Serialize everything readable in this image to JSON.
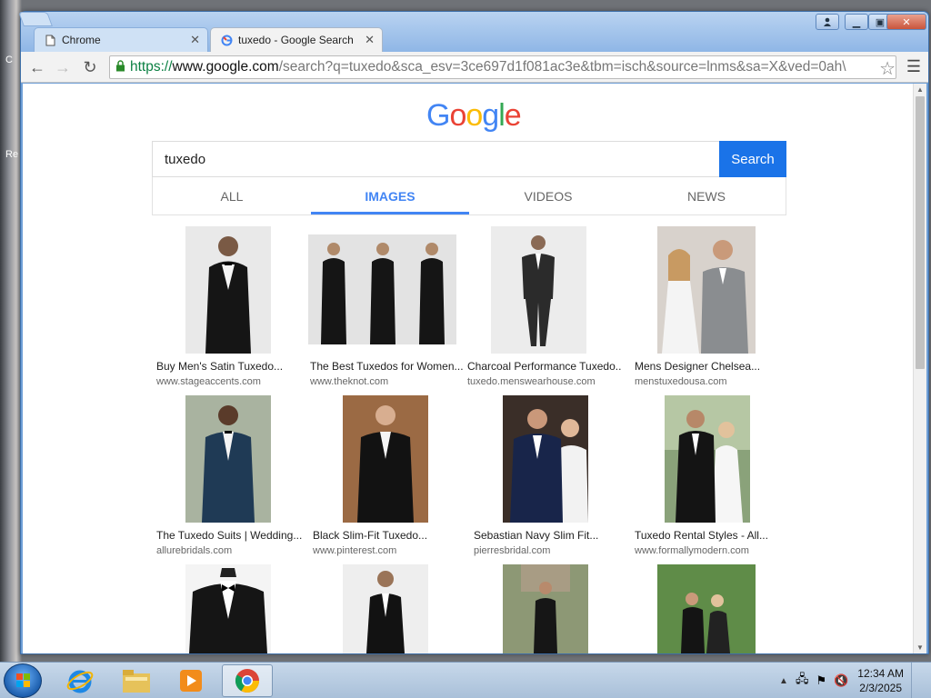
{
  "desktop": {
    "label_1": "C",
    "label_2": "Re"
  },
  "tabs": [
    {
      "title": "Chrome"
    },
    {
      "title": "tuxedo - Google Search"
    }
  ],
  "toolbar": {
    "url_scheme": "https://",
    "url_host": "www.google.com",
    "url_rest": "/search?q=tuxedo&sca_esv=3ce697d1f081ac3e&tbm=isch&source=lnms&sa=X&ved=0ah\\"
  },
  "page": {
    "logo": "Google",
    "search_value": "tuxedo",
    "search_button": "Search",
    "tabs": [
      "ALL",
      "IMAGES",
      "VIDEOS",
      "NEWS"
    ]
  },
  "results": [
    {
      "title": "Buy Men's Satin Tuxedo...",
      "source": "www.stageaccents.com"
    },
    {
      "title": "The Best Tuxedos for Women...",
      "source": "www.theknot.com"
    },
    {
      "title": "Charcoal Performance Tuxedo...",
      "source": "tuxedo.menswearhouse.com"
    },
    {
      "title": "Mens Designer Chelsea...",
      "source": "menstuxedousa.com"
    },
    {
      "title": "The Tuxedo Suits | Wedding...",
      "source": "allurebridals.com"
    },
    {
      "title": "Black Slim-Fit Tuxedo...",
      "source": "www.pinterest.com"
    },
    {
      "title": "Sebastian Navy Slim Fit...",
      "source": "pierresbridal.com"
    },
    {
      "title": "Tuxedo Rental Styles - All...",
      "source": "www.formallymodern.com"
    }
  ],
  "taskbar": {
    "time": "12:34 AM",
    "date": "2/3/2025"
  },
  "colors": {
    "google_blue": "#4285f4",
    "search_button": "#1a73e8",
    "window_frame": "#6f9fd6"
  }
}
